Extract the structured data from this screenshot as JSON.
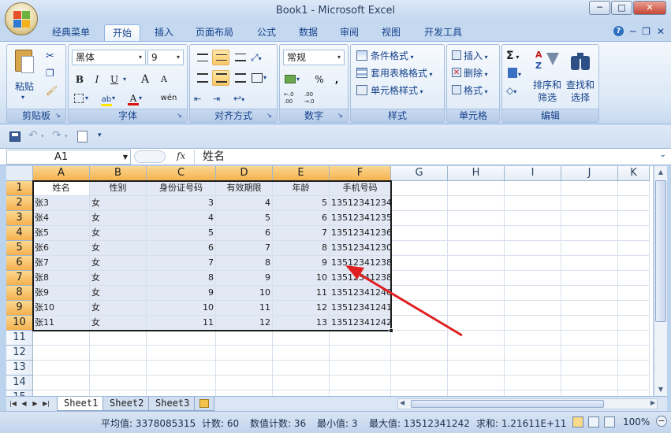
{
  "window": {
    "title": "Book1 - Microsoft Excel",
    "minimize": "─",
    "maximize": "□",
    "close": "✕"
  },
  "tabs": [
    "经典菜单",
    "开始",
    "插入",
    "页面布局",
    "公式",
    "数据",
    "审阅",
    "视图",
    "开发工具"
  ],
  "active_tab": "开始",
  "ribbon": {
    "clipboard": {
      "label": "剪贴板",
      "paste": "粘贴"
    },
    "font": {
      "label": "字体",
      "font_name": "黑体",
      "font_size": "9",
      "bold": "B",
      "italic": "I",
      "underline": "U",
      "grow": "A",
      "shrink": "A",
      "phonetic": "wén",
      "text_color_letter": "A",
      "highlight_letter": "ab"
    },
    "alignment": {
      "label": "对齐方式"
    },
    "number": {
      "label": "数字",
      "format": "常规",
      "percent": "%",
      "comma": ",",
      "inc_decimal": "←.0\n.00",
      "dec_decimal": ".00\n→.0"
    },
    "styles": {
      "label": "样式",
      "conditional": "条件格式",
      "table_format": "套用表格格式",
      "cell_styles": "单元格样式"
    },
    "cells": {
      "label": "单元格",
      "insert": "插入",
      "delete": "删除",
      "format": "格式"
    },
    "editing": {
      "label": "编辑",
      "sigma": "Σ",
      "sort_filter_1": "排序和",
      "sort_filter_2": "筛选",
      "find_select_1": "查找和",
      "find_select_2": "选择"
    }
  },
  "formula_bar": {
    "name_box": "A1",
    "fx": "fx",
    "formula": "姓名"
  },
  "columns": [
    "A",
    "B",
    "C",
    "D",
    "E",
    "F",
    "G",
    "H",
    "I",
    "J",
    "K"
  ],
  "rows": [
    "1",
    "2",
    "3",
    "4",
    "5",
    "6",
    "7",
    "8",
    "9",
    "10",
    "11",
    "12",
    "13",
    "14",
    "15"
  ],
  "headers": [
    "姓名",
    "性别",
    "身份证号码",
    "有效期限",
    "年龄",
    "手机号码"
  ],
  "data_rows": [
    [
      "张3",
      "女",
      "3",
      "4",
      "5",
      "13512341234"
    ],
    [
      "张4",
      "女",
      "4",
      "5",
      "6",
      "13512341235"
    ],
    [
      "张5",
      "女",
      "5",
      "6",
      "7",
      "13512341236"
    ],
    [
      "张6",
      "女",
      "6",
      "7",
      "8",
      "13512341230"
    ],
    [
      "张7",
      "女",
      "7",
      "8",
      "9",
      "13512341238"
    ],
    [
      "张8",
      "女",
      "8",
      "9",
      "10",
      "13512341238"
    ],
    [
      "张9",
      "女",
      "9",
      "10",
      "11",
      "13512341240"
    ],
    [
      "张10",
      "女",
      "10",
      "11",
      "12",
      "13512341241"
    ],
    [
      "张11",
      "女",
      "11",
      "12",
      "13",
      "13512341242"
    ]
  ],
  "sheets": [
    "Sheet1",
    "Sheet2",
    "Sheet3"
  ],
  "active_sheet": "Sheet1",
  "status": {
    "average": "平均值: 3378085315",
    "count": "计数: 60",
    "numeric_count": "数值计数: 36",
    "min": "最小值: 3",
    "max": "最大值: 13512341242",
    "sum": "求和: 1.21611E+11",
    "zoom": "100%"
  },
  "colors": {
    "selection_header": "#f5b14f",
    "annotation_arrow": "#e02020"
  }
}
